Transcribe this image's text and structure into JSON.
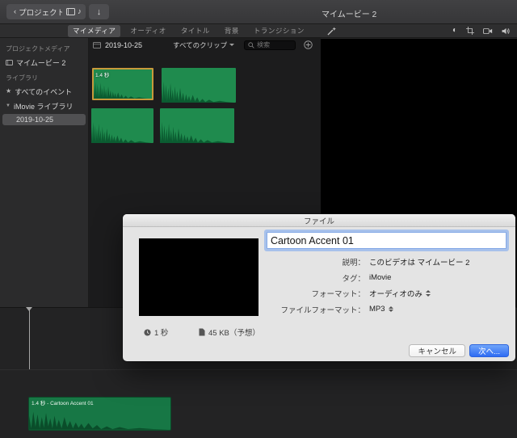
{
  "window": {
    "title": "マイムービー 2"
  },
  "toolbar": {
    "back_label": "プロジェクト"
  },
  "icons": {
    "chevron_left": "‹",
    "music_note": "♪",
    "arrow_down": "↓",
    "star": "★",
    "disclosure_down": "▼",
    "color_wheel": "◐"
  },
  "tabs": [
    {
      "label": "マイメディア",
      "active": true
    },
    {
      "label": "オーディオ",
      "active": false
    },
    {
      "label": "タイトル",
      "active": false
    },
    {
      "label": "背景",
      "active": false
    },
    {
      "label": "トランジション",
      "active": false
    }
  ],
  "sidebar": {
    "sections": [
      {
        "header": "プロジェクトメディア",
        "items": [
          {
            "label": "マイムービー 2"
          }
        ]
      },
      {
        "header": "ライブラリ",
        "items": [
          {
            "label": "すべてのイベント"
          },
          {
            "label": "iMovie ライブラリ"
          },
          {
            "label": "2019-10-25",
            "selected": true
          }
        ]
      }
    ]
  },
  "browser": {
    "event_title": "2019-10-25",
    "filter_label": "すべてのクリップ",
    "search_placeholder": "検索",
    "clips": [
      {
        "duration": "1.4 秒",
        "selected": true
      },
      {
        "duration": "",
        "selected": false
      },
      {
        "duration": "",
        "selected": false
      },
      {
        "duration": "",
        "selected": false
      }
    ]
  },
  "dialog": {
    "title": "ファイル",
    "filename": "Cartoon Accent 01",
    "rows": [
      {
        "label": "説明：",
        "value": "このビデオは マイムービー 2"
      },
      {
        "label": "タグ：",
        "value": "iMovie"
      },
      {
        "label": "フォーマット：",
        "value": "オーディオのみ"
      },
      {
        "label": "ファイルフォーマット：",
        "value": "MP3"
      }
    ],
    "duration": "1 秒",
    "size": "45 KB（予想）",
    "cancel_label": "キャンセル",
    "next_label": "次へ..."
  },
  "timeline": {
    "clip_label": "1.4 秒 - Cartoon Accent 01"
  },
  "colors": {
    "clip_green": "#1f8b4e",
    "selection_orange": "#c79a3b",
    "primary_blue": "#2f6cf3",
    "focus_ring": "#5e96f5"
  }
}
